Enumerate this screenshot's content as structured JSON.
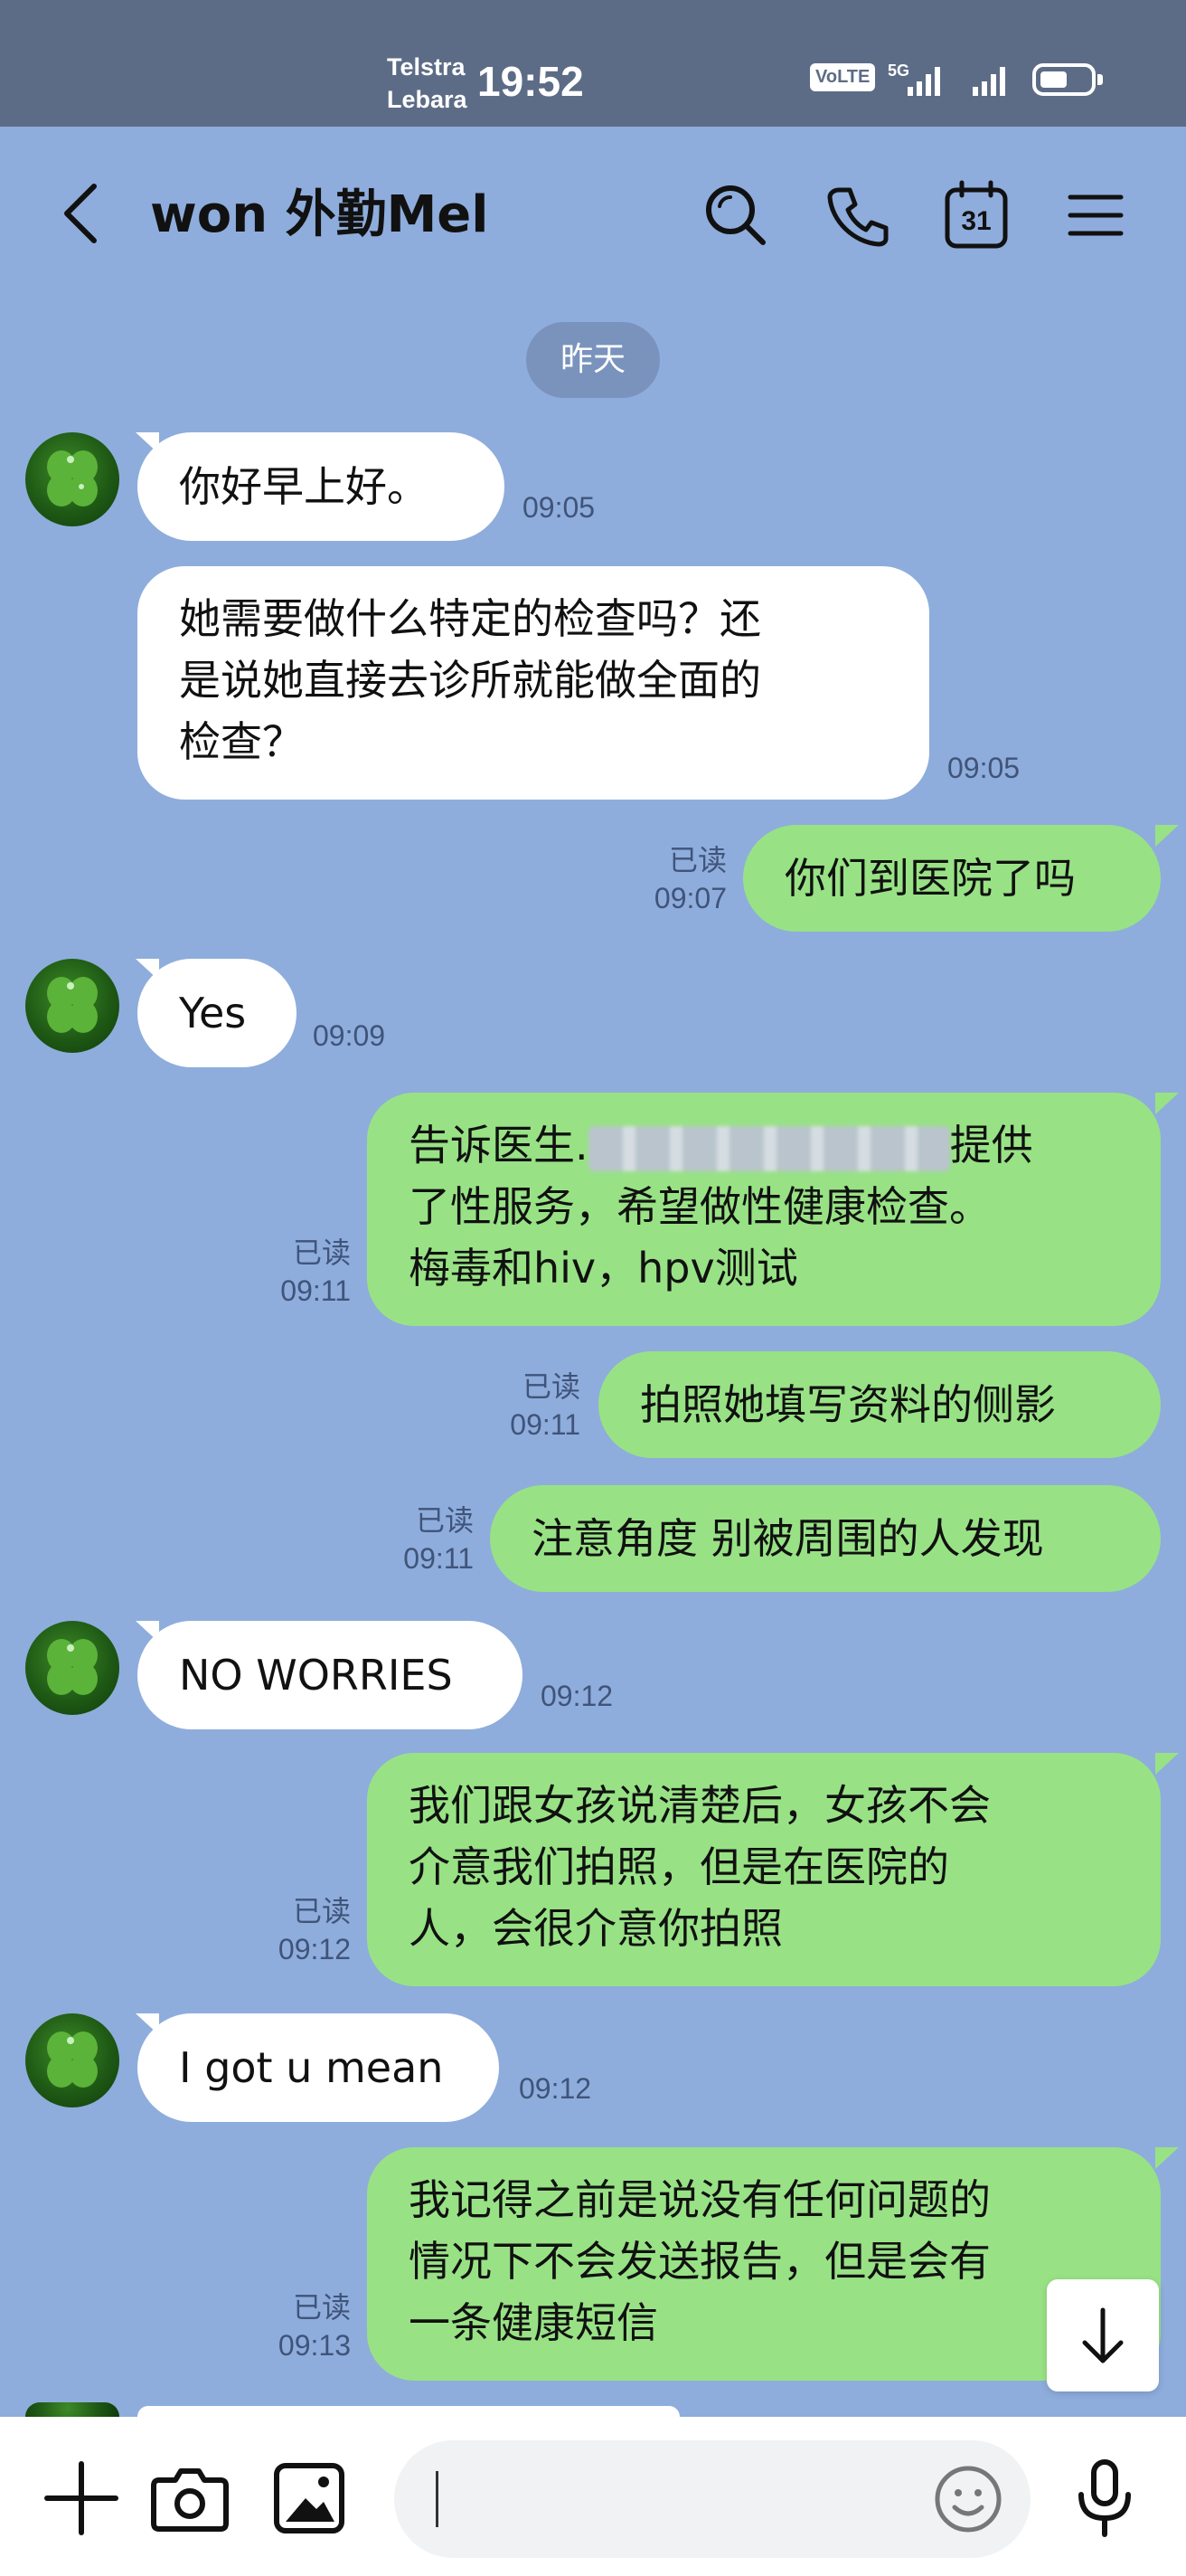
{
  "status_bar": {
    "carrier_1": "Telstra",
    "carrier_2": "Lebara",
    "time": "19:52",
    "volte_label": "VoLTE",
    "network_label": "5G",
    "battery_level": 0.55
  },
  "header": {
    "title": "won 外勤Mel",
    "icons": [
      "back-chevron-icon",
      "search-icon",
      "phone-icon",
      "calendar-icon",
      "menu-icon"
    ],
    "calendar_day": "31"
  },
  "date_separator": "昨天",
  "colors": {
    "chat_background": "#8eaddc",
    "incoming_bubble": "#ffffff",
    "outgoing_bubble": "#98e285",
    "status_bar": "#5d6c86",
    "meta_text": "#40547a"
  },
  "messages": [
    {
      "direction": "in",
      "lines": [
        "你好早上好。"
      ],
      "time": "09:05"
    },
    {
      "direction": "in",
      "lines": [
        "她需要做什么特定的检查吗？还",
        "是说她直接去诊所就能做全面的",
        "检查？"
      ],
      "time": "09:05"
    },
    {
      "direction": "out",
      "lines": [
        "你们到医院了吗"
      ],
      "read": "已读",
      "time": "09:07"
    },
    {
      "direction": "in",
      "lines": [
        "Yes"
      ],
      "time": "09:09"
    },
    {
      "direction": "out",
      "lines": [
        "告诉医生.",
        "提供",
        "了性服务，希望做性健康检查。",
        "梅毒和hiv，hpv测试"
      ],
      "read": "已读",
      "time": "09:11"
    },
    {
      "direction": "out",
      "lines": [
        "拍照她填写资料的侧影"
      ],
      "read": "已读",
      "time": "09:11"
    },
    {
      "direction": "out",
      "lines": [
        "注意角度 别被周围的人发现"
      ],
      "read": "已读",
      "time": "09:11"
    },
    {
      "direction": "in",
      "lines": [
        "NO WORRIES"
      ],
      "time": "09:12"
    },
    {
      "direction": "out",
      "lines": [
        "我们跟女孩说清楚后，女孩不会",
        "介意我们拍照，但是在医院的",
        "人，会很介意你拍照"
      ],
      "read": "已读",
      "time": "09:12"
    },
    {
      "direction": "in",
      "lines": [
        "I got u mean"
      ],
      "time": "09:12"
    },
    {
      "direction": "out",
      "lines": [
        "我记得之前是说没有任何问题的",
        "情况下不会发送报告，但是会有",
        "一条健康短信"
      ],
      "read": "已读",
      "time": "09:13"
    }
  ],
  "input_bar": {
    "placeholder": "",
    "icons": [
      "plus-icon",
      "camera-icon",
      "image-icon",
      "emoji-icon",
      "microphone-icon"
    ]
  }
}
